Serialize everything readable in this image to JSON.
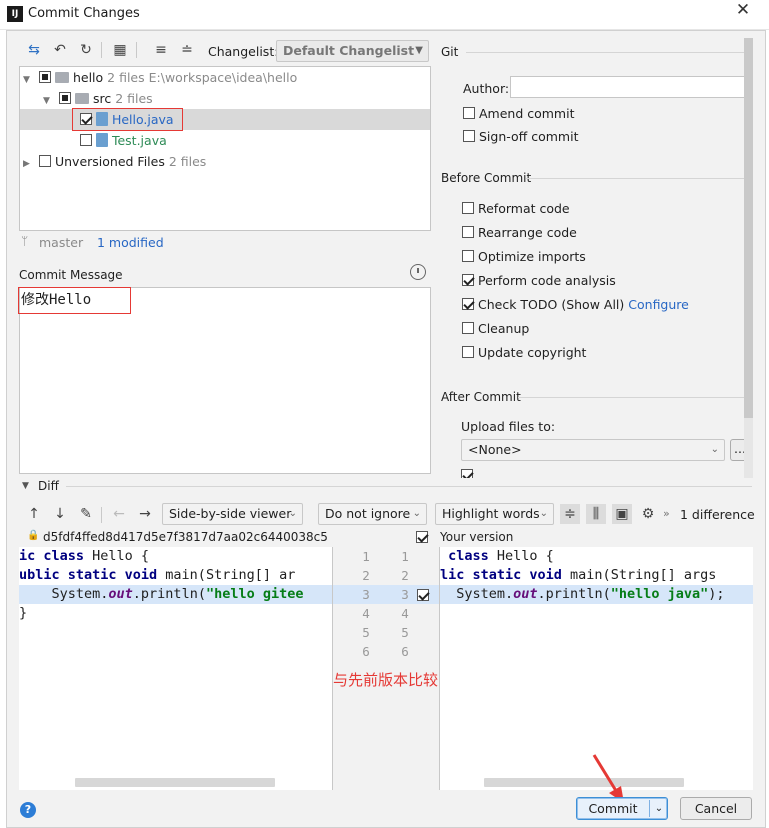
{
  "window": {
    "title": "Commit Changes",
    "app_icon": "IJ",
    "close_glyph": "✕"
  },
  "toolbar": {
    "changelist_label": "Changelist:",
    "changelist_value": "Default Changelist"
  },
  "tree": {
    "root": {
      "name": "hello",
      "count": "2 files",
      "path": "E:\\workspace\\idea\\hello"
    },
    "src": {
      "name": "src",
      "count": "2 files"
    },
    "files": [
      {
        "name": "Hello.java",
        "checked": true
      },
      {
        "name": "Test.java",
        "checked": false
      }
    ],
    "unversioned": {
      "name": "Unversioned Files",
      "count": "2 files"
    }
  },
  "status": {
    "branch": "master",
    "modified": "1 modified"
  },
  "commit_message": {
    "label": "Commit Message",
    "text": "修改Hello"
  },
  "git": {
    "section": "Git",
    "author_label": "Author:",
    "author_value": "",
    "amend": "Amend commit",
    "signoff": "Sign-off commit"
  },
  "before_commit": {
    "section": "Before Commit",
    "options": [
      {
        "label": "Reformat code",
        "checked": false
      },
      {
        "label": "Rearrange code",
        "checked": false
      },
      {
        "label": "Optimize imports",
        "checked": false
      },
      {
        "label": "Perform code analysis",
        "checked": true
      },
      {
        "label": "Check TODO (Show All)",
        "checked": true
      },
      {
        "label": "Cleanup",
        "checked": false
      },
      {
        "label": "Update copyright",
        "checked": false
      }
    ],
    "configure_link": "Configure"
  },
  "after_commit": {
    "section": "After Commit",
    "upload_label": "Upload files to:",
    "upload_value": "<None>",
    "browse": "..."
  },
  "diff": {
    "section": "Diff",
    "viewer": "Side-by-side viewer",
    "ignore": "Do not ignore",
    "highlight": "Highlight words",
    "differences": "1 difference",
    "left_title": "d5fdf4ffed8d417d5e7f3817d7aa02c6440038c5",
    "right_title": "Your version",
    "left_lines": [
      "ic class Hello {",
      "ublic static void main(String[] ar",
      "    System.out.println(\"hello gitee",
      "}"
    ],
    "right_lines": [
      " class Hello {",
      "lic static void main(String[] args",
      ".  System.out.println(\"hello java\");"
    ],
    "line_numbers": [
      "1",
      "2",
      "3",
      "4",
      "5",
      "6"
    ]
  },
  "annotation": "与先前版本比较",
  "buttons": {
    "commit": "Commit",
    "cancel": "Cancel",
    "help": "?"
  },
  "colors": {
    "link": "#2867c4",
    "highlight": "#d6e6f9",
    "annotation": "#e53935",
    "help": "#2d7dd6"
  }
}
